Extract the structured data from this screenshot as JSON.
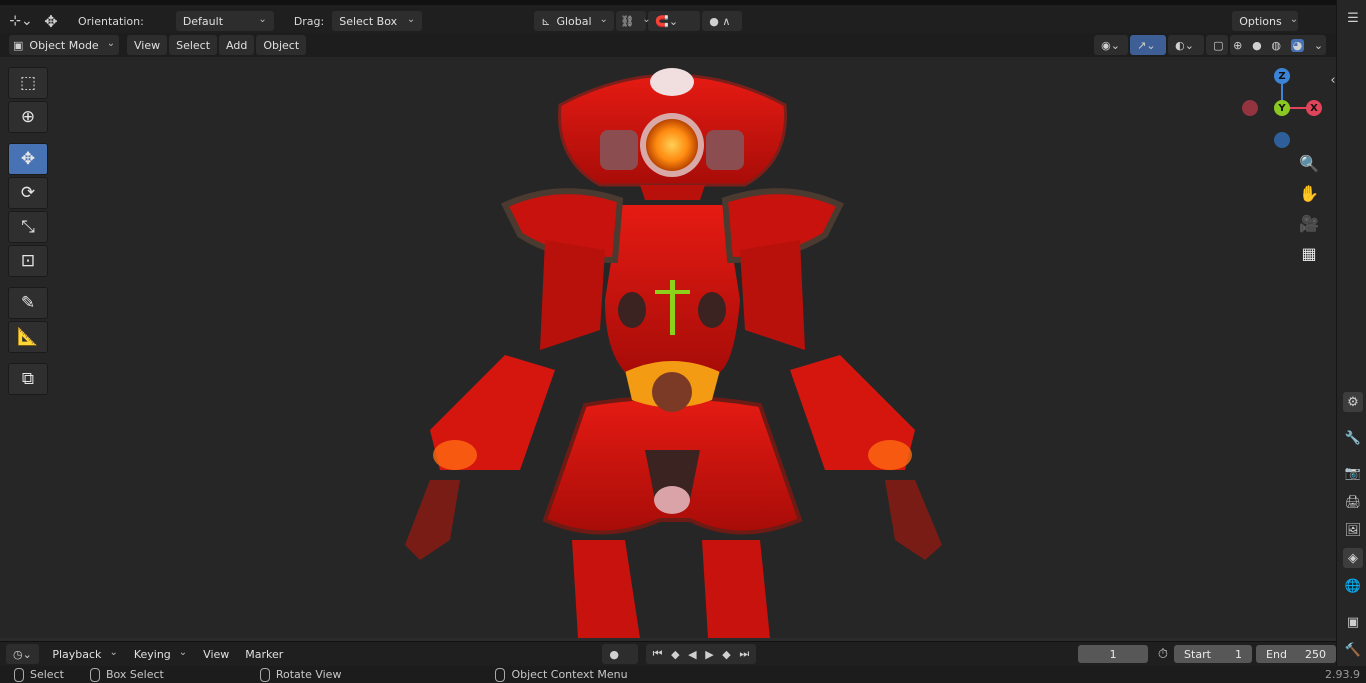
{
  "toolbar": {
    "orientation_label": "Orientation:",
    "orientation_value": "Default",
    "drag_label": "Drag:",
    "drag_value": "Select Box",
    "transform_orientation": "Global",
    "options_label": "Options"
  },
  "header": {
    "mode": "Object Mode",
    "menus": [
      "View",
      "Select",
      "Add",
      "Object"
    ]
  },
  "gizmo": {
    "z": "Z",
    "y": "Y",
    "x": "X"
  },
  "timeline": {
    "menus": [
      "Playback",
      "Keying",
      "View",
      "Marker"
    ],
    "current_frame": "1",
    "start_label": "Start",
    "start_value": "1",
    "end_label": "End",
    "end_value": "250"
  },
  "status": {
    "select": "Select",
    "box_select": "Box Select",
    "rotate_view": "Rotate View",
    "context_menu": "Object Context Menu",
    "version": "2.93.9"
  },
  "colors": {
    "active_tool": "#4772b3",
    "axis_x": "#e0445a",
    "axis_y": "#8ac921",
    "axis_z": "#3b84d8",
    "model_red": "#d3120e"
  },
  "icons": [
    "editor-type-icon",
    "move-icon",
    "cursor-icon",
    "transform-icon",
    "rotate-icon",
    "scale-icon",
    "annotate-icon",
    "measure-icon",
    "add-cube-icon",
    "zoom-icon",
    "hand-icon",
    "camera-icon",
    "grid-icon",
    "wrench-icon",
    "world-icon",
    "scene-icon",
    "render-icon",
    "output-icon",
    "view-layer-icon",
    "object-icon",
    "tool-icon"
  ]
}
